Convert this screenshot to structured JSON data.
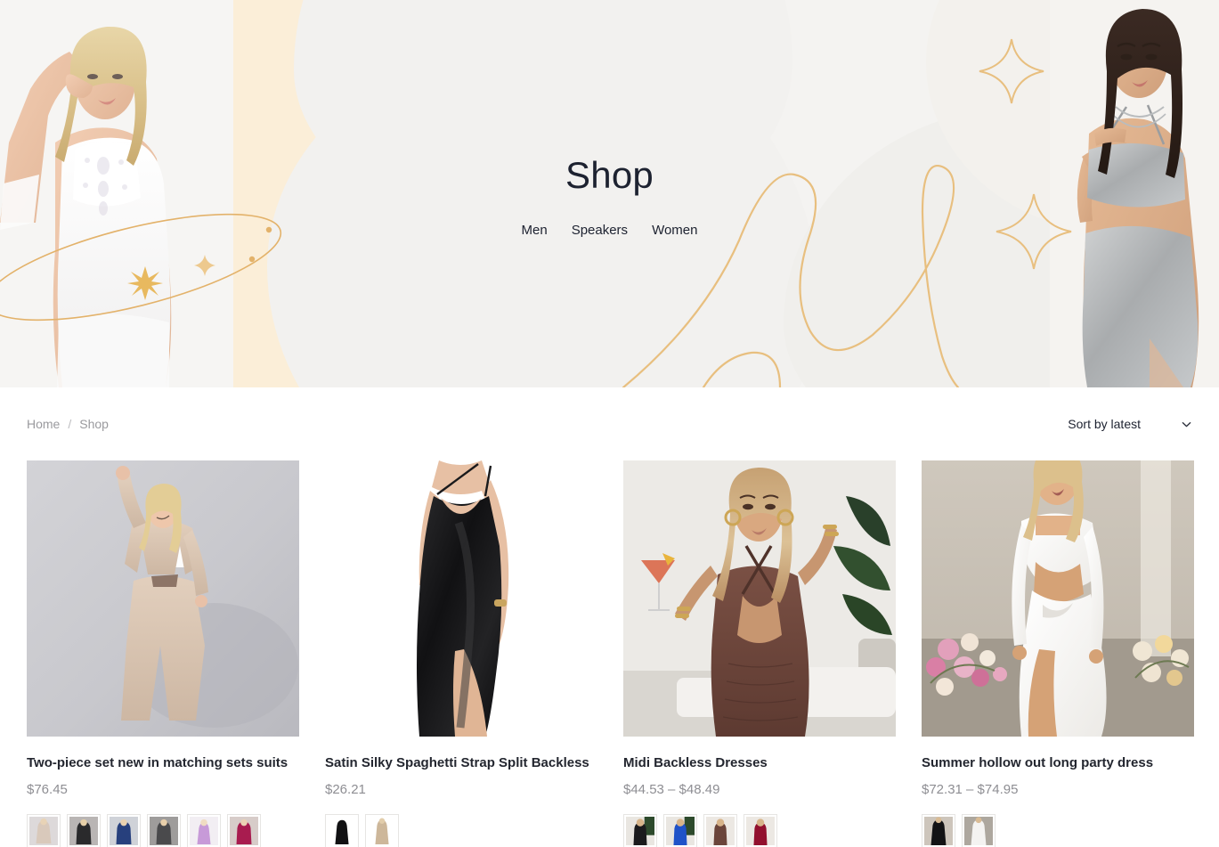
{
  "hero": {
    "title": "Shop",
    "nav": [
      {
        "label": "Men"
      },
      {
        "label": "Speakers"
      },
      {
        "label": "Women"
      }
    ],
    "decor": {
      "sparkle_icon": "four-point-star-icon",
      "orbit_icon": "orbit-ellipse-icon",
      "ribbon_icon": "gold-ribbon-curve-icon",
      "gold": "#e3b26a",
      "cream": "#fbeed8",
      "background": "#f4f3f1"
    },
    "models": {
      "left_alt": "blonde model in white lace bodycon dress",
      "right_alt": "dark haired model in silver glitter two-piece set"
    }
  },
  "toolbar": {
    "breadcrumb": {
      "home": "Home",
      "separator": "/",
      "current": "Shop"
    },
    "sort": {
      "label": "Sort by latest",
      "icon": "chevron-down-icon",
      "options": [
        "Sort by latest"
      ]
    }
  },
  "products": [
    {
      "title": "Two-piece set new in matching sets suits",
      "price": "$76.45",
      "image_alt": "blonde model dancing in beige cropped blazer and wide leg trousers",
      "swatches": [
        {
          "name": "beige",
          "color": "#d9c9bb",
          "bg": "#ddd9da"
        },
        {
          "name": "black",
          "color": "#2a2a2c",
          "bg": "#b9b5b4"
        },
        {
          "name": "navy",
          "color": "#27407d",
          "bg": "#cfd2d8"
        },
        {
          "name": "charcoal",
          "color": "#4a4a4c",
          "bg": "#9e9c9b"
        },
        {
          "name": "lilac",
          "color": "#c79ad8",
          "bg": "#f2eef3"
        },
        {
          "name": "fuchsia",
          "color": "#a81c4f",
          "bg": "#d7ccc9"
        }
      ]
    },
    {
      "title": "Satin Silky Spaghetti Strap Split Backless",
      "price": "$26.21",
      "image_alt": "model in black satin spaghetti strap split backless dress",
      "swatches": [
        {
          "name": "black",
          "color": "#111113",
          "bg": "#ffffff"
        },
        {
          "name": "champagne",
          "color": "#cdb79a",
          "bg": "#ffffff"
        }
      ]
    },
    {
      "title": "Midi Backless Dresses",
      "price": "$44.53 – $48.49",
      "image_alt": "model holding cocktail wearing brown ruched midi backless dress",
      "swatches": [
        {
          "name": "black",
          "color": "#1b1b1d",
          "bg": "#e9e6e1"
        },
        {
          "name": "blue",
          "color": "#1f52c8",
          "bg": "#e9e6e1"
        },
        {
          "name": "brown",
          "color": "#6b453b",
          "bg": "#ece8e3"
        },
        {
          "name": "red",
          "color": "#92102e",
          "bg": "#ece8e3"
        }
      ]
    },
    {
      "title": "Summer hollow out long party dress",
      "price": "$72.31 – $74.95",
      "image_alt": "blonde model in white cutout long sleeve party dress with flowers",
      "swatches": [
        {
          "name": "black",
          "color": "#131315",
          "bg": "#cdc5bb"
        },
        {
          "name": "white",
          "color": "#f4f3f1",
          "bg": "#ada79e"
        }
      ]
    }
  ]
}
